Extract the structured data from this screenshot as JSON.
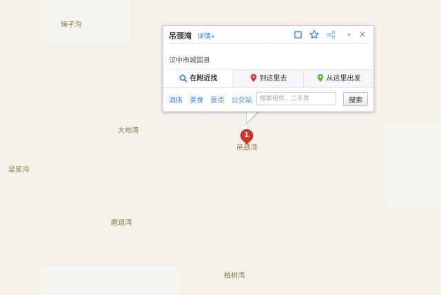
{
  "map": {
    "place_labels": [
      "辣子沟",
      "大地湾",
      "梁家沟",
      "吊颈湾",
      "磨道湾",
      "柏树湾"
    ]
  },
  "marker": {
    "number": "1"
  },
  "popup": {
    "title": "吊颈湾",
    "detail_link": "详情»",
    "tool_icons": [
      "square-icon",
      "star-icon",
      "share-icon",
      "dropdown-icon",
      "close-icon"
    ],
    "close_symbol": "×",
    "address": "汉中市城固县",
    "tabs": [
      {
        "label": "在附近找",
        "icon": "search-icon",
        "color": "#3385ff",
        "active": true
      },
      {
        "label": "到这里去",
        "icon": "pin-icon",
        "color": "#e0281d",
        "active": false
      },
      {
        "label": "从这里出发",
        "icon": "pin-icon",
        "color": "#5cb531",
        "active": false
      }
    ],
    "quick_links": [
      "酒店",
      "美食",
      "景点",
      "公交站"
    ],
    "search": {
      "placeholder": "搜索租房、二手房",
      "button_label": "搜索"
    }
  },
  "colors": {
    "map_background": "#f4f2ea",
    "place_label": "#8a7d38",
    "link": "#3385ff",
    "marker": "#d9332b"
  }
}
